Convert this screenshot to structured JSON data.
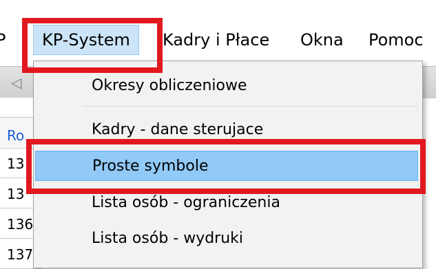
{
  "menubar": {
    "edge_label": "P",
    "items": [
      {
        "label": "KP-System"
      },
      {
        "label": "Kadry i Płace"
      },
      {
        "label": "Okna"
      },
      {
        "label": "Pomoc"
      }
    ]
  },
  "background_grid": {
    "header": "Ro",
    "rows": [
      "13",
      "13",
      "136",
      "137"
    ]
  },
  "dropdown": {
    "items": [
      {
        "label": "Okresy obliczeniowe"
      },
      {
        "label": "Kadry - dane sterujace"
      },
      {
        "label": "Proste symbole",
        "highlighted": true
      },
      {
        "label": "Lista osób - ograniczenia"
      },
      {
        "label": "Lista osób - wydruki"
      }
    ]
  },
  "colors": {
    "highlight": "#91c9f7",
    "menu_active": "#cce4f7",
    "annotation_red": "#e1181f"
  }
}
